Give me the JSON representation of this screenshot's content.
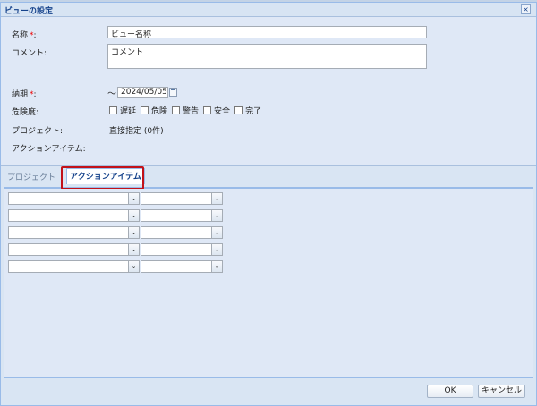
{
  "dialog": {
    "title": "ビューの設定",
    "close_symbol": "×"
  },
  "form": {
    "name_label": "名称",
    "name_value": "ビュー名称",
    "comment_label": "コメント:",
    "comment_value": "コメント",
    "deadline_label": "納期",
    "deadline_value": "2024/05/05",
    "required_mark": "*",
    "required_colon": ":",
    "tilde": "〜",
    "risk_label": "危険度:",
    "risk_options": [
      "遅延",
      "危険",
      "警告",
      "安全",
      "完了"
    ],
    "project_label": "プロジェクト:",
    "project_value": "直接指定 (0件)",
    "action_item_label": "アクションアイテム:"
  },
  "tabs": [
    {
      "label": "プロジェクト",
      "active": false
    },
    {
      "label": "アクションアイテム",
      "active": true
    }
  ],
  "filter_rows": 5,
  "buttons": {
    "ok": "OK",
    "cancel": "キャンセル"
  },
  "colors": {
    "title_text": "#15428b",
    "highlight": "#c21219",
    "required": "#ee0000"
  },
  "icons": [
    "close-icon",
    "calendar-icon",
    "chevron-down-icon"
  ]
}
